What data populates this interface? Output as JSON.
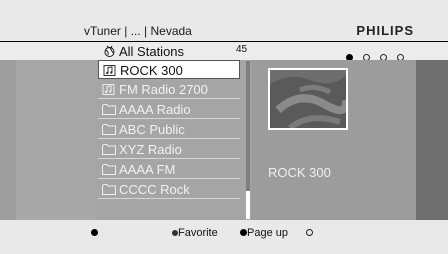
{
  "header": {
    "breadcrumb": "vTuner | ... | Nevada",
    "brand": "PHILIPS"
  },
  "stations_row": {
    "label": "All Stations",
    "count": "45",
    "pager": {
      "total": 4,
      "current": 1
    }
  },
  "station_list": {
    "items": [
      {
        "label": "ROCK 300",
        "icon": "note-icon",
        "selected": true
      },
      {
        "label": "FM Radio 2700",
        "icon": "note-icon",
        "selected": false
      },
      {
        "label": "AAAA Radio",
        "icon": "folder-icon",
        "selected": false
      },
      {
        "label": "ABC Public",
        "icon": "folder-icon",
        "selected": false
      },
      {
        "label": "XYZ Radio",
        "icon": "folder-icon",
        "selected": false
      },
      {
        "label": "AAAA FM",
        "icon": "folder-icon",
        "selected": false
      },
      {
        "label": "CCCC Rock",
        "icon": "folder-icon",
        "selected": false
      }
    ]
  },
  "now_playing": {
    "station": "ROCK 300"
  },
  "footer": {
    "favorite_label": "Favorite",
    "page_up_label": "Page up"
  },
  "colors": {
    "header_bg": "#e9e9e9",
    "main_bg": "#a8a8a8",
    "selected_bg": "#ffffff",
    "text_light": "#f2f2f2"
  }
}
